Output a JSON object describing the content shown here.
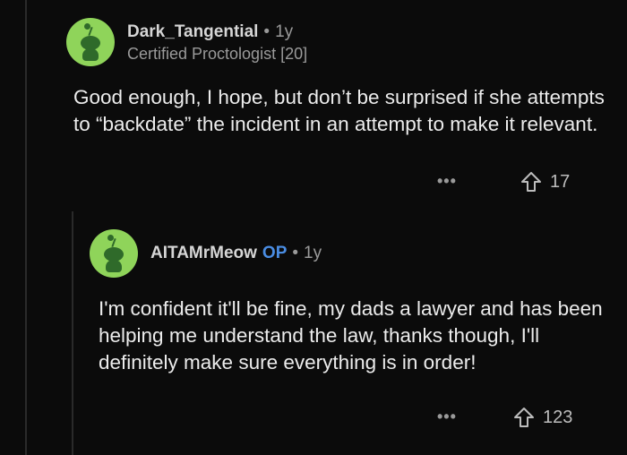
{
  "comments": [
    {
      "username": "Dark_Tangential",
      "separator": "•",
      "age": "1y",
      "flair": "Certified Proctologist [20]",
      "body": "Good enough, I hope, but don’t be surprised if she attempts to “backdate” the incident in an attempt to make it relevant.",
      "more": "•••",
      "votes": "17"
    },
    {
      "username": "AITAMrMeow",
      "op_badge": "OP",
      "separator": "•",
      "age": "1y",
      "body": "I'm confident it'll be fine, my dads a lawyer and has been helping me understand the law, thanks though, I'll definitely make sure everything is in order!",
      "more": "•••",
      "votes": "123"
    }
  ],
  "icons": {
    "avatar": "snoo-avatar-icon",
    "upvote": "upvote-arrow-icon",
    "more": "more-options-icon"
  },
  "colors": {
    "background": "#0b0b0b",
    "op_badge": "#4a8de3",
    "avatar": "#8fd45a"
  }
}
